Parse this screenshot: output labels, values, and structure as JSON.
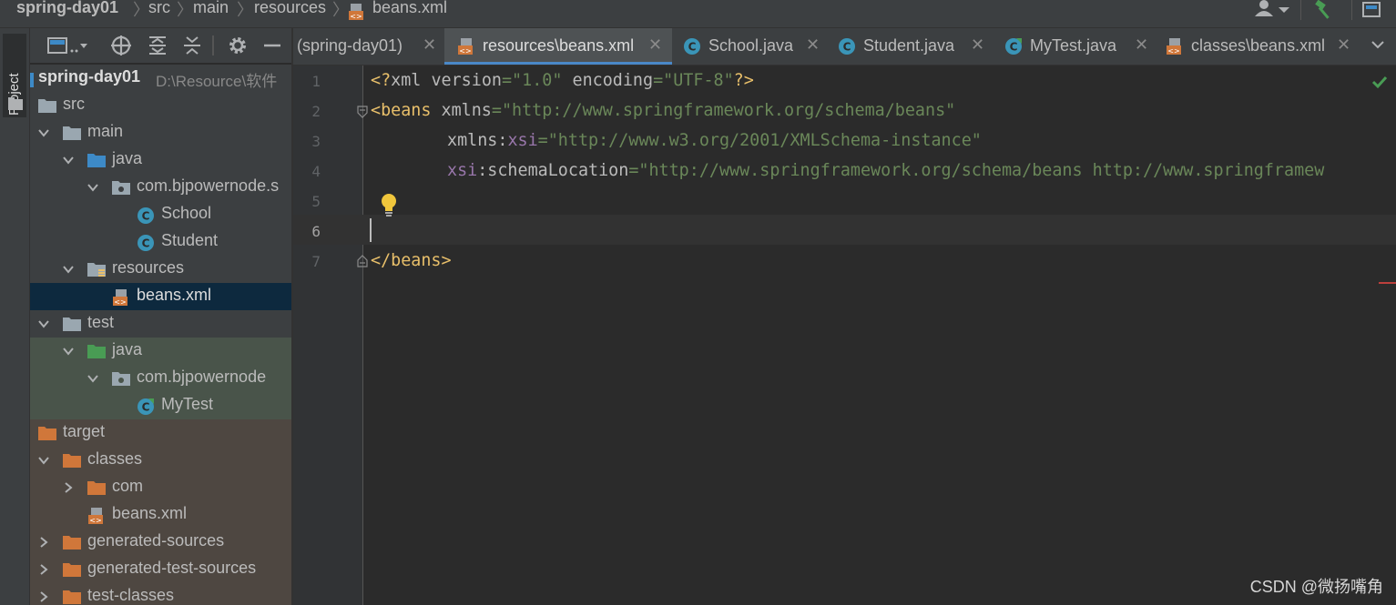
{
  "breadcrumb": [
    "spring-day01",
    "src",
    "main",
    "resources",
    "beans.xml"
  ],
  "left_stripe": {
    "project_label": "Project"
  },
  "project_tree": {
    "rows": [
      {
        "label": "spring-day01",
        "path": "D:\\Resource\\软件"
      },
      {
        "label": "src"
      },
      {
        "label": "main"
      },
      {
        "label": "java"
      },
      {
        "label": "com.bjpowernode.s"
      },
      {
        "label": "School"
      },
      {
        "label": "Student"
      },
      {
        "label": "resources"
      },
      {
        "label": "beans.xml"
      },
      {
        "label": "test"
      },
      {
        "label": "java"
      },
      {
        "label": "com.bjpowernode"
      },
      {
        "label": "MyTest"
      },
      {
        "label": "target"
      },
      {
        "label": "classes"
      },
      {
        "label": "com"
      },
      {
        "label": "beans.xml"
      },
      {
        "label": "generated-sources"
      },
      {
        "label": "generated-test-sources"
      },
      {
        "label": "test-classes"
      }
    ]
  },
  "tabs": [
    {
      "label": "(spring-day01)",
      "icon": "none"
    },
    {
      "label": "resources\\beans.xml",
      "icon": "xml-file-icon",
      "active": true
    },
    {
      "label": "School.java",
      "icon": "class-icon"
    },
    {
      "label": "Student.java",
      "icon": "class-icon"
    },
    {
      "label": "MyTest.java",
      "icon": "test-class-icon"
    },
    {
      "label": "classes\\beans.xml",
      "icon": "xml-file-icon"
    }
  ],
  "editor": {
    "line_numbers": [
      "1",
      "2",
      "3",
      "4",
      "5",
      "6",
      "7"
    ],
    "lines": {
      "l1": {
        "p1": "<?",
        "p2": "xml ",
        "p3": "version",
        "p4": "=",
        "p5": "\"1.0\"",
        "p6": " encoding",
        "p7": "=",
        "p8": "\"UTF-8\"",
        "p9": "?>"
      },
      "l2": {
        "p1": "<beans ",
        "p2": "xmlns",
        "p3": "=",
        "p4": "\"http://www.springframework.org/schema/beans\""
      },
      "l3": {
        "p1": "xmlns:",
        "p2": "xsi",
        "p3": "=",
        "p4": "\"http://www.w3.org/2001/XMLSchema-instance\""
      },
      "l4": {
        "p1": "xsi",
        "p2": ":schemaLocation",
        "p3": "=",
        "p4": "\"http://www.springframework.org/schema/beans http://www.springframew"
      },
      "l7": {
        "p1": "</beans>"
      }
    }
  },
  "watermark": "CSDN @微扬嘴角",
  "colors": {
    "tag": "#e8bf6a",
    "string": "#6a8759",
    "namespace": "#9876aa",
    "selection": "#0d293e",
    "test_bg": "#49544a",
    "excluded_bg": "#4e4741",
    "source_folder": "#3d8ac7",
    "test_folder": "#499c54",
    "excluded_folder": "#d0773a"
  }
}
